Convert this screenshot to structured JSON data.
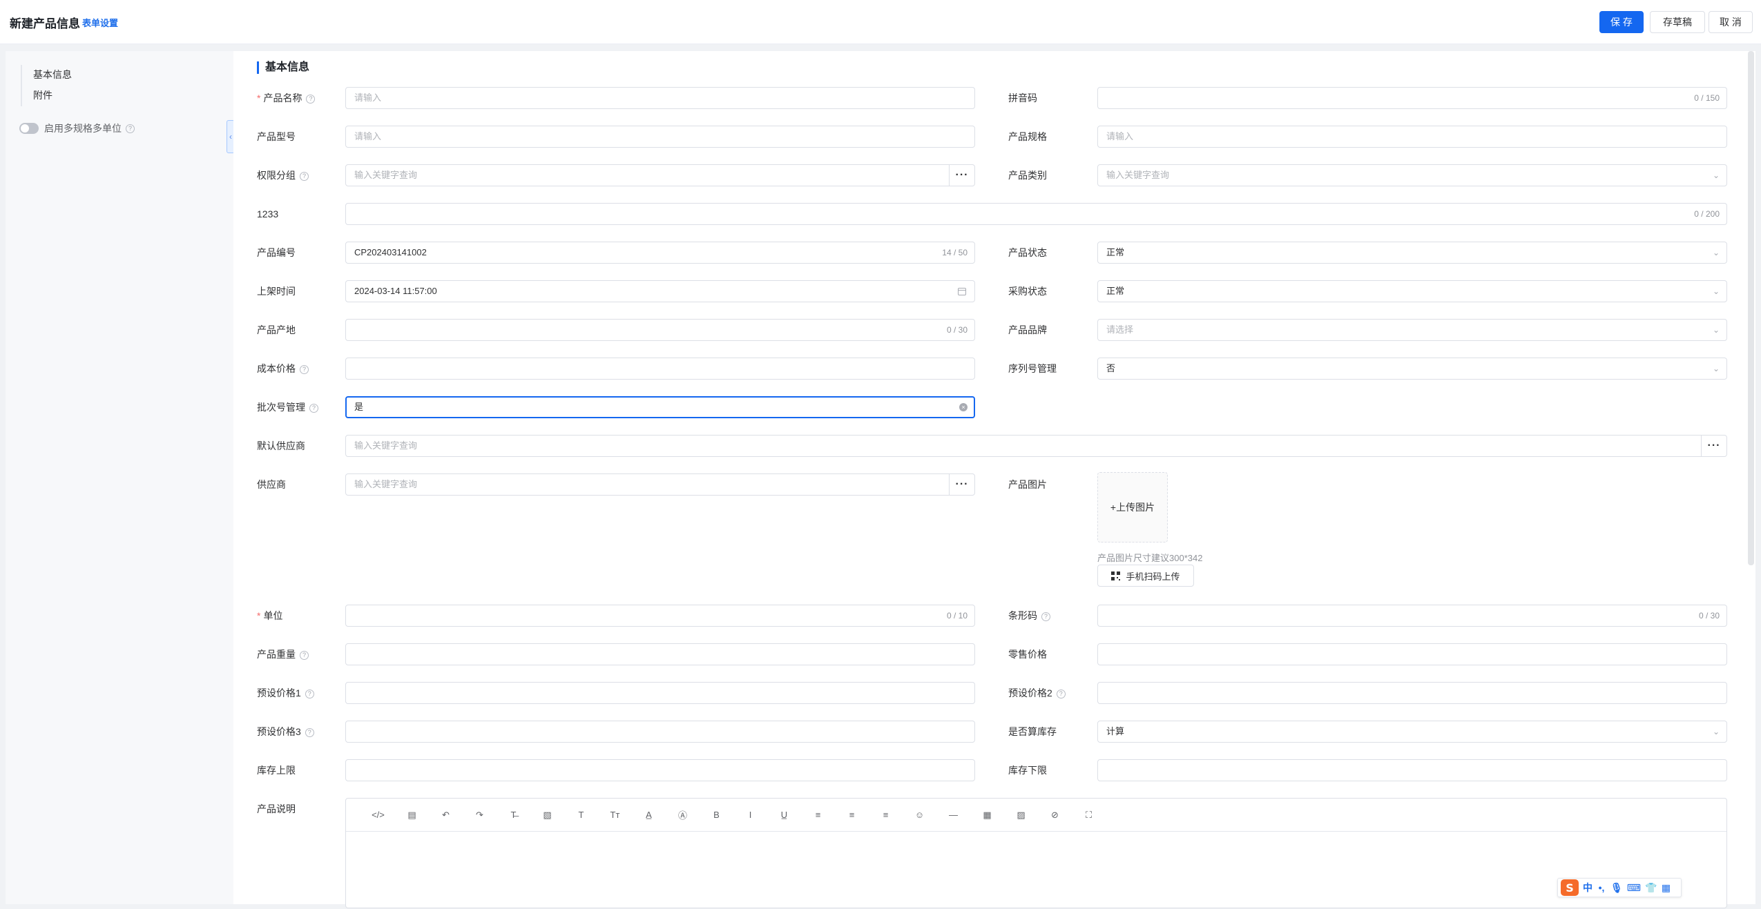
{
  "header": {
    "title": "新建产品信息",
    "settings_link": "表单设置",
    "save_label": "保 存",
    "draft_label": "存草稿",
    "cancel_label": "取 消"
  },
  "sidebar": {
    "items": [
      {
        "label": "基本信息"
      },
      {
        "label": "附件"
      }
    ],
    "multi_spec_label": "启用多规格多单位",
    "multi_spec_enabled": false,
    "collapse_icon": "chevron-left-icon"
  },
  "section": {
    "title": "基本信息"
  },
  "fields": {
    "product_name": {
      "label": "产品名称",
      "placeholder": "请输入",
      "required": true
    },
    "pinyin": {
      "label": "拼音码",
      "counter": "0 / 150"
    },
    "model": {
      "label": "产品型号",
      "placeholder": "请输入"
    },
    "spec": {
      "label": "产品规格",
      "placeholder": "请输入"
    },
    "perm_group": {
      "label": "权限分组",
      "placeholder": "输入关键字查询"
    },
    "category": {
      "label": "产品类别",
      "placeholder": "输入关键字查询"
    },
    "custom_1233": {
      "label": "1233",
      "counter": "0 / 200"
    },
    "code": {
      "label": "产品编号",
      "value": "CP202403141002",
      "counter": "14 / 50"
    },
    "status": {
      "label": "产品状态",
      "value": "正常"
    },
    "listed_time": {
      "label": "上架时间",
      "value": "2024-03-14 11:57:00"
    },
    "purchase_status": {
      "label": "采购状态",
      "value": "正常"
    },
    "origin": {
      "label": "产品产地",
      "counter": "0 / 30"
    },
    "brand": {
      "label": "产品品牌",
      "placeholder": "请选择"
    },
    "cost_price": {
      "label": "成本价格"
    },
    "serial_mgmt": {
      "label": "序列号管理",
      "value": "否"
    },
    "batch_mgmt": {
      "label": "批次号管理",
      "value": "是"
    },
    "default_supplier": {
      "label": "默认供应商",
      "placeholder": "输入关键字查询"
    },
    "supplier": {
      "label": "供应商",
      "placeholder": "输入关键字查询"
    },
    "product_image": {
      "label": "产品图片",
      "upload_label": "+上传图片",
      "hint": "产品图片尺寸建议300*342",
      "scan_label": "手机扫码上传"
    },
    "unit": {
      "label": "单位",
      "counter": "0 / 10",
      "required": true
    },
    "barcode": {
      "label": "条形码",
      "counter": "0 / 30"
    },
    "weight": {
      "label": "产品重量"
    },
    "retail_price": {
      "label": "零售价格"
    },
    "preset_price1": {
      "label": "预设价格1"
    },
    "preset_price2": {
      "label": "预设价格2"
    },
    "preset_price3": {
      "label": "预设价格3"
    },
    "count_inventory": {
      "label": "是否算库存",
      "value": "计算"
    },
    "stock_max": {
      "label": "库存上限"
    },
    "stock_min": {
      "label": "库存下限"
    },
    "description": {
      "label": "产品说明"
    }
  },
  "editor_toolbar": [
    {
      "name": "code-view-icon",
      "glyph": "</>"
    },
    {
      "name": "template-icon",
      "glyph": "▤"
    },
    {
      "name": "undo-icon",
      "glyph": "↶"
    },
    {
      "name": "redo-icon",
      "glyph": "↷"
    },
    {
      "name": "strikethrough-icon",
      "glyph": "T̶"
    },
    {
      "name": "paste-text-icon",
      "glyph": "▧"
    },
    {
      "name": "font-size-icon",
      "glyph": "T"
    },
    {
      "name": "line-height-icon",
      "glyph": "Tт"
    },
    {
      "name": "font-color-icon",
      "glyph": "A̲"
    },
    {
      "name": "background-color-icon",
      "glyph": "Ⓐ"
    },
    {
      "name": "bold-icon",
      "glyph": "B"
    },
    {
      "name": "italic-icon",
      "glyph": "I"
    },
    {
      "name": "underline-icon",
      "glyph": "U̲"
    },
    {
      "name": "align-left-icon",
      "glyph": "≡"
    },
    {
      "name": "align-center-icon",
      "glyph": "≡"
    },
    {
      "name": "align-right-icon",
      "glyph": "≡"
    },
    {
      "name": "emoji-icon",
      "glyph": "☺"
    },
    {
      "name": "horizontal-rule-icon",
      "glyph": "—"
    },
    {
      "name": "table-icon",
      "glyph": "▦"
    },
    {
      "name": "image-icon",
      "glyph": "▨"
    },
    {
      "name": "attachment-icon",
      "glyph": "⊘"
    },
    {
      "name": "fullscreen-icon",
      "glyph": "⛶"
    }
  ],
  "ime": {
    "logo": "S",
    "items": [
      {
        "name": "chinese-mode-icon",
        "glyph": "中"
      },
      {
        "name": "punctuation-icon",
        "glyph": "•,"
      },
      {
        "name": "microphone-icon",
        "glyph": "🎙"
      },
      {
        "name": "keyboard-icon",
        "glyph": "⌨"
      },
      {
        "name": "skin-icon",
        "glyph": "👕"
      },
      {
        "name": "toolbox-icon",
        "glyph": "▦"
      }
    ]
  },
  "colors": {
    "primary": "#1467f0",
    "required": "#f56c6c"
  }
}
